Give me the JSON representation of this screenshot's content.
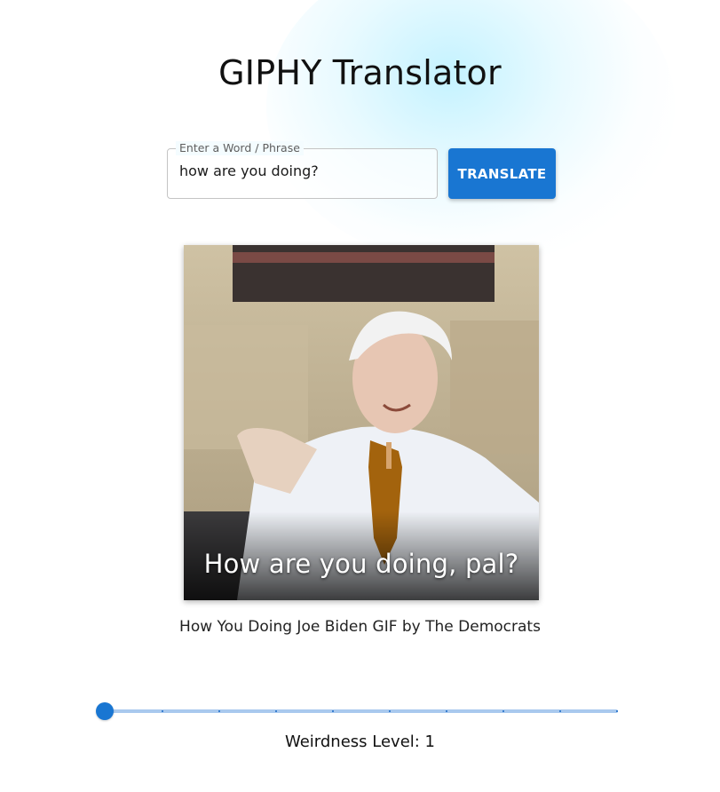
{
  "app": {
    "title": "GIPHY Translator"
  },
  "search": {
    "label": "Enter a Word / Phrase",
    "value": "how are you doing?"
  },
  "translate_button": {
    "label": "TRANSLATE"
  },
  "gif": {
    "overlay_text": "How are you doing, pal?",
    "caption": "How You Doing Joe Biden GIF by The Democrats"
  },
  "weirdness": {
    "label": "Weirdness Level: 1",
    "value": 1,
    "min": 0,
    "max": 10
  },
  "colors": {
    "accent": "#1976d2",
    "rail": "#a9c9ee"
  }
}
